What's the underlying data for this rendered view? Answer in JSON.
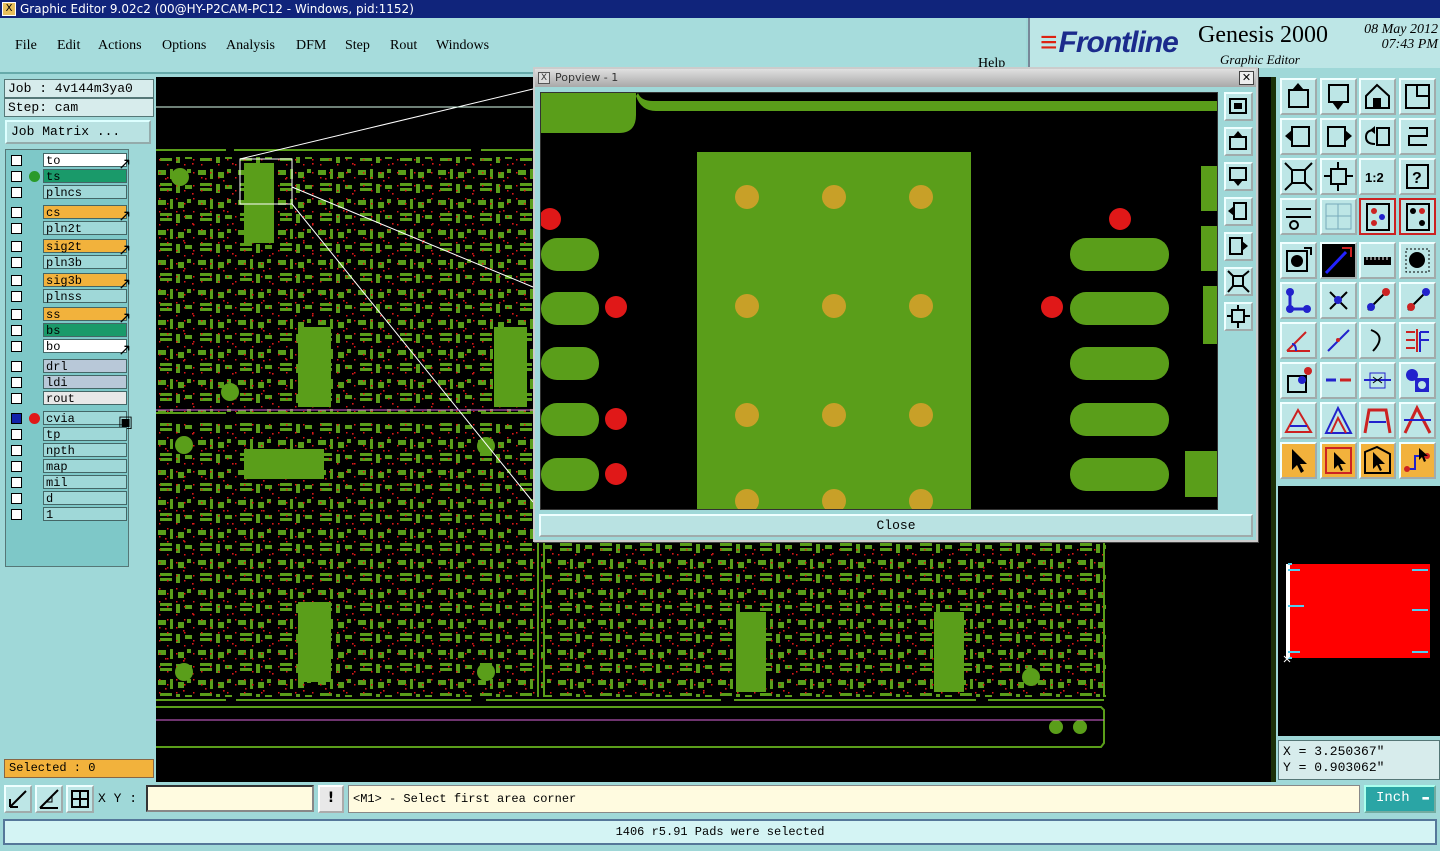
{
  "window": {
    "title": "Graphic Editor 9.02c2 (00@HY-P2CAM-PC12 - Windows, pid:1152)"
  },
  "menu": {
    "items": [
      {
        "label": "File"
      },
      {
        "label": "Edit"
      },
      {
        "label": "Actions"
      },
      {
        "label": "Options"
      },
      {
        "label": "Analysis"
      },
      {
        "label": "DFM"
      },
      {
        "label": "Step"
      },
      {
        "label": "Rout"
      },
      {
        "label": "Windows"
      }
    ],
    "help": "Help"
  },
  "brand": {
    "logo_text": "Frontline",
    "product": "Genesis 2000",
    "subtitle": "Graphic Editor",
    "date": "08 May 2012",
    "time": "07:43 PM"
  },
  "job": {
    "job_label": "Job : 4v144m3ya0",
    "step_label": "Step: cam",
    "matrix_button": "Job Matrix ..."
  },
  "layers": [
    {
      "name": "to",
      "color": "#ffffff",
      "tag": "↗"
    },
    {
      "name": "ts",
      "color": "#1a9a6a",
      "tag": "",
      "dot": "#2a9a2a"
    },
    {
      "name": "plncs",
      "color": "#9fd8d8",
      "tag": ""
    },
    {
      "name": "cs",
      "color": "#f2b23c",
      "tag": "↗"
    },
    {
      "name": "pln2t",
      "color": "#9fd8d8",
      "tag": ""
    },
    {
      "name": "sig2t",
      "color": "#f2b23c",
      "tag": "↗"
    },
    {
      "name": "pln3b",
      "color": "#9fd8d8",
      "tag": ""
    },
    {
      "name": "sig3b",
      "color": "#f2b23c",
      "tag": "↗"
    },
    {
      "name": "plnss",
      "color": "#9fd8d8",
      "tag": ""
    },
    {
      "name": "ss",
      "color": "#f2b23c",
      "tag": "↗"
    },
    {
      "name": "bs",
      "color": "#1a9a6a",
      "tag": ""
    },
    {
      "name": "bo",
      "color": "#ffffff",
      "tag": "↗"
    },
    {
      "name": "drl",
      "color": "#b8c8d8",
      "tag": ""
    },
    {
      "name": "ldi",
      "color": "#b8c8d8",
      "tag": ""
    },
    {
      "name": "rout",
      "color": "#e8e8e8",
      "tag": ""
    },
    {
      "name": "cvia",
      "color": "#9fd8d8",
      "tag": "▣",
      "dot": "#e01818",
      "selected": true
    },
    {
      "name": "tp",
      "color": "#9fd8d8",
      "tag": ""
    },
    {
      "name": "npth",
      "color": "#9fd8d8",
      "tag": ""
    },
    {
      "name": "map",
      "color": "#9fd8d8",
      "tag": ""
    },
    {
      "name": "mil",
      "color": "#9fd8d8",
      "tag": ""
    },
    {
      "name": "d",
      "color": "#9fd8d8",
      "tag": ""
    },
    {
      "name": "1",
      "color": "#9fd8d8",
      "tag": ""
    }
  ],
  "selected_count": "Selected : 0",
  "popview": {
    "title": "Popview - 1",
    "close_label": "Close"
  },
  "coords": {
    "x": "X = 3.250367\"",
    "y": "Y = 0.903062\""
  },
  "bottom": {
    "xy_label": "X Y :",
    "xy_value": "",
    "excl": "!",
    "prompt": "<M1> - Select first area corner",
    "unit": "Inch"
  },
  "status": "1406 r5.91 Pads were selected",
  "colors": {
    "copper": "#5a9e1a",
    "gold": "#c8a028",
    "red_pad": "#e01818",
    "accent_orange": "#f2b23c",
    "background": "#9fd8d8"
  }
}
